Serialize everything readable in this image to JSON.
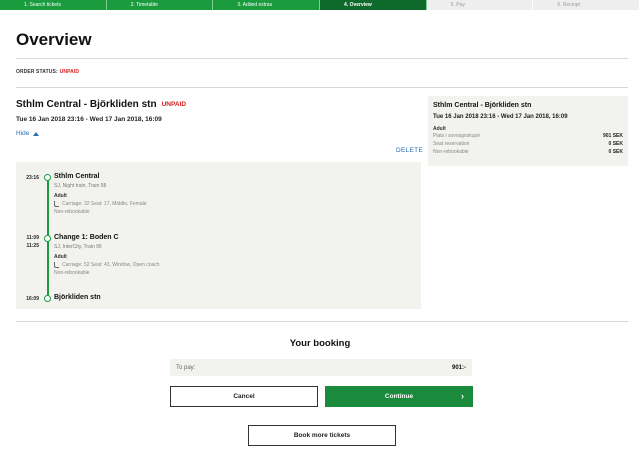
{
  "steps": [
    {
      "label": "1. Search tickets",
      "state": "done"
    },
    {
      "label": "2. Timetable",
      "state": "done"
    },
    {
      "label": "3. Added extras",
      "state": "done"
    },
    {
      "label": "4. Overview",
      "state": "current"
    },
    {
      "label": "5. Pay",
      "state": "future"
    },
    {
      "label": "6. Receipt",
      "state": "future"
    }
  ],
  "page_title": "Overview",
  "order_status": {
    "label": "ORDER STATUS:",
    "value": "UNPAID"
  },
  "trip": {
    "title": "Sthlm Central - Björkliden stn",
    "status": "UNPAID",
    "dates": "Tue 16 Jan 2018 23:16 - Wed 17 Jan 2018, 16:09",
    "hide_label": "Hide",
    "delete_label": "DELETE"
  },
  "journey": {
    "stop1": {
      "time": "23:16",
      "station": "Sthlm Central",
      "train": "SJ, Night train, Train 98",
      "passenger": "Adult",
      "seat": "Carriage: 32 Seat: 17, Middle, Female",
      "rebook": "Non-rebookable"
    },
    "stop2": {
      "time_arr": "11:09",
      "time_dep": "11:25",
      "station": "Change 1: Boden C",
      "train": "SJ, InterCity, Train 96",
      "passenger": "Adult",
      "seat": "Carriage: 52 Seat: 43, Window, Open coach",
      "rebook": "Non-rebookable"
    },
    "stop3": {
      "time": "16:09",
      "station": "Björkliden stn"
    }
  },
  "summary": {
    "title": "Sthlm Central - Björkliden stn",
    "dates": "Tue 16 Jan 2018 23:16 - Wed 17 Jan 2018, 16:09",
    "passenger": "Adult",
    "rows": [
      {
        "label": "Plats i sovvagnskupé",
        "price": "901 SEK"
      },
      {
        "label": "Seat reservation",
        "price": "0 SEK"
      },
      {
        "label": "Non-rebookable",
        "price": "0 SEK"
      }
    ]
  },
  "booking": {
    "heading": "Your booking",
    "to_pay_label": "To pay:",
    "to_pay_amount": "901:-",
    "cancel_label": "Cancel",
    "continue_label": "Continue",
    "book_more_label": "Book more tickets"
  },
  "colors": {
    "accent": "#1a9c3e",
    "accent_dark": "#0d6a2b",
    "alert": "#d81e1e",
    "link": "#2a6bb5",
    "panel": "#f2f2ee"
  }
}
